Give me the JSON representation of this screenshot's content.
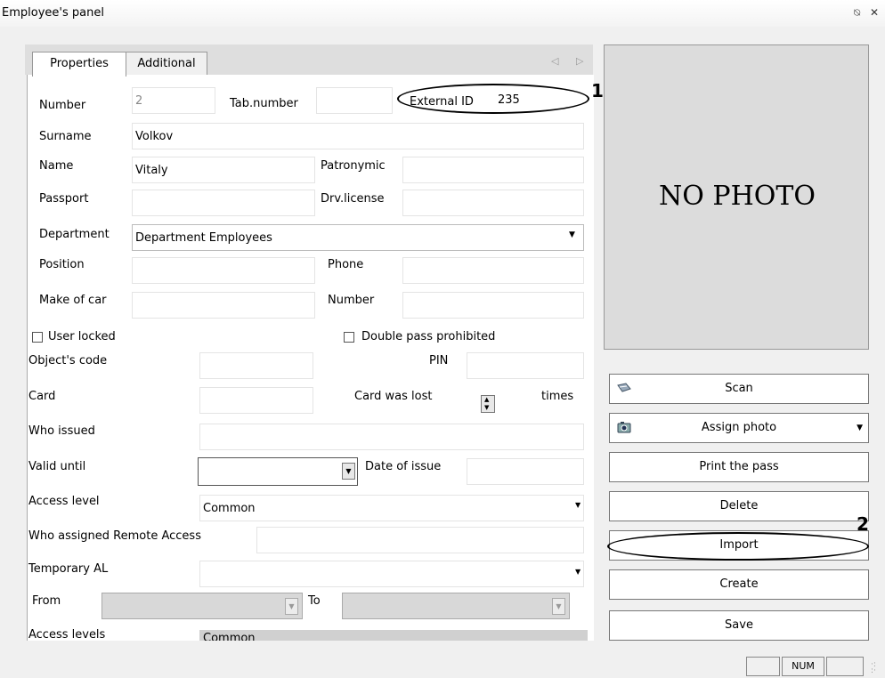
{
  "window": {
    "title": "Employee's panel",
    "pin_glyph": "⍉",
    "close_glyph": "✕"
  },
  "tabs": [
    {
      "label": "Properties",
      "active": true
    },
    {
      "label": "Additional",
      "active": false
    }
  ],
  "tab_arrows": "◁ ▷",
  "form": {
    "number": {
      "label": "Number",
      "value": "2"
    },
    "tab_number": {
      "label": "Tab.number",
      "value": ""
    },
    "external_id": {
      "label": "External ID",
      "value": "235"
    },
    "surname": {
      "label": "Surname",
      "value": "Volkov"
    },
    "name": {
      "label": "Name",
      "value": "Vitaly"
    },
    "patronymic": {
      "label": "Patronymic",
      "value": ""
    },
    "passport": {
      "label": "Passport",
      "value": ""
    },
    "drv_license": {
      "label": "Drv.license",
      "value": ""
    },
    "department": {
      "label": "Department",
      "value": "Department Employees"
    },
    "position": {
      "label": "Position",
      "value": ""
    },
    "phone": {
      "label": "Phone",
      "value": ""
    },
    "make_of_car": {
      "label": "Make of car",
      "value": ""
    },
    "car_number": {
      "label": "Number",
      "value": ""
    },
    "user_locked": {
      "label": "User locked",
      "checked": false
    },
    "double_pass": {
      "label": "Double pass prohibited",
      "checked": false
    },
    "objects_code": {
      "label": "Object's code",
      "value": ""
    },
    "pin": {
      "label": "PIN",
      "value": ""
    },
    "card": {
      "label": "Card",
      "value": ""
    },
    "card_was_lost": {
      "label": "Card was lost",
      "suffix": "times"
    },
    "who_issued": {
      "label": "Who issued",
      "value": ""
    },
    "valid_until": {
      "label": "Valid until",
      "value": ""
    },
    "date_of_issue": {
      "label": "Date of issue",
      "value": ""
    },
    "access_level": {
      "label": "Access level",
      "value": "Common"
    },
    "who_assigned_remote": {
      "label": "Who assigned Remote Access",
      "value": ""
    },
    "temporary_al": {
      "label": "Temporary AL",
      "value": ""
    },
    "from": {
      "label": "From"
    },
    "to": {
      "label": "To"
    },
    "access_levels": {
      "label": "Access levels",
      "value": "Common"
    }
  },
  "photo": {
    "placeholder": "NO PHOTO"
  },
  "buttons": {
    "scan": "Scan",
    "assign_photo": "Assign photo",
    "print_pass": "Print the pass",
    "delete": "Delete",
    "import": "Import",
    "create": "Create",
    "save": "Save"
  },
  "callouts": {
    "one": "1",
    "two": "2"
  },
  "status_bar": {
    "num": "NUM"
  },
  "glyphs": {
    "down_arrow": "▼",
    "up_arrow": "▲"
  }
}
